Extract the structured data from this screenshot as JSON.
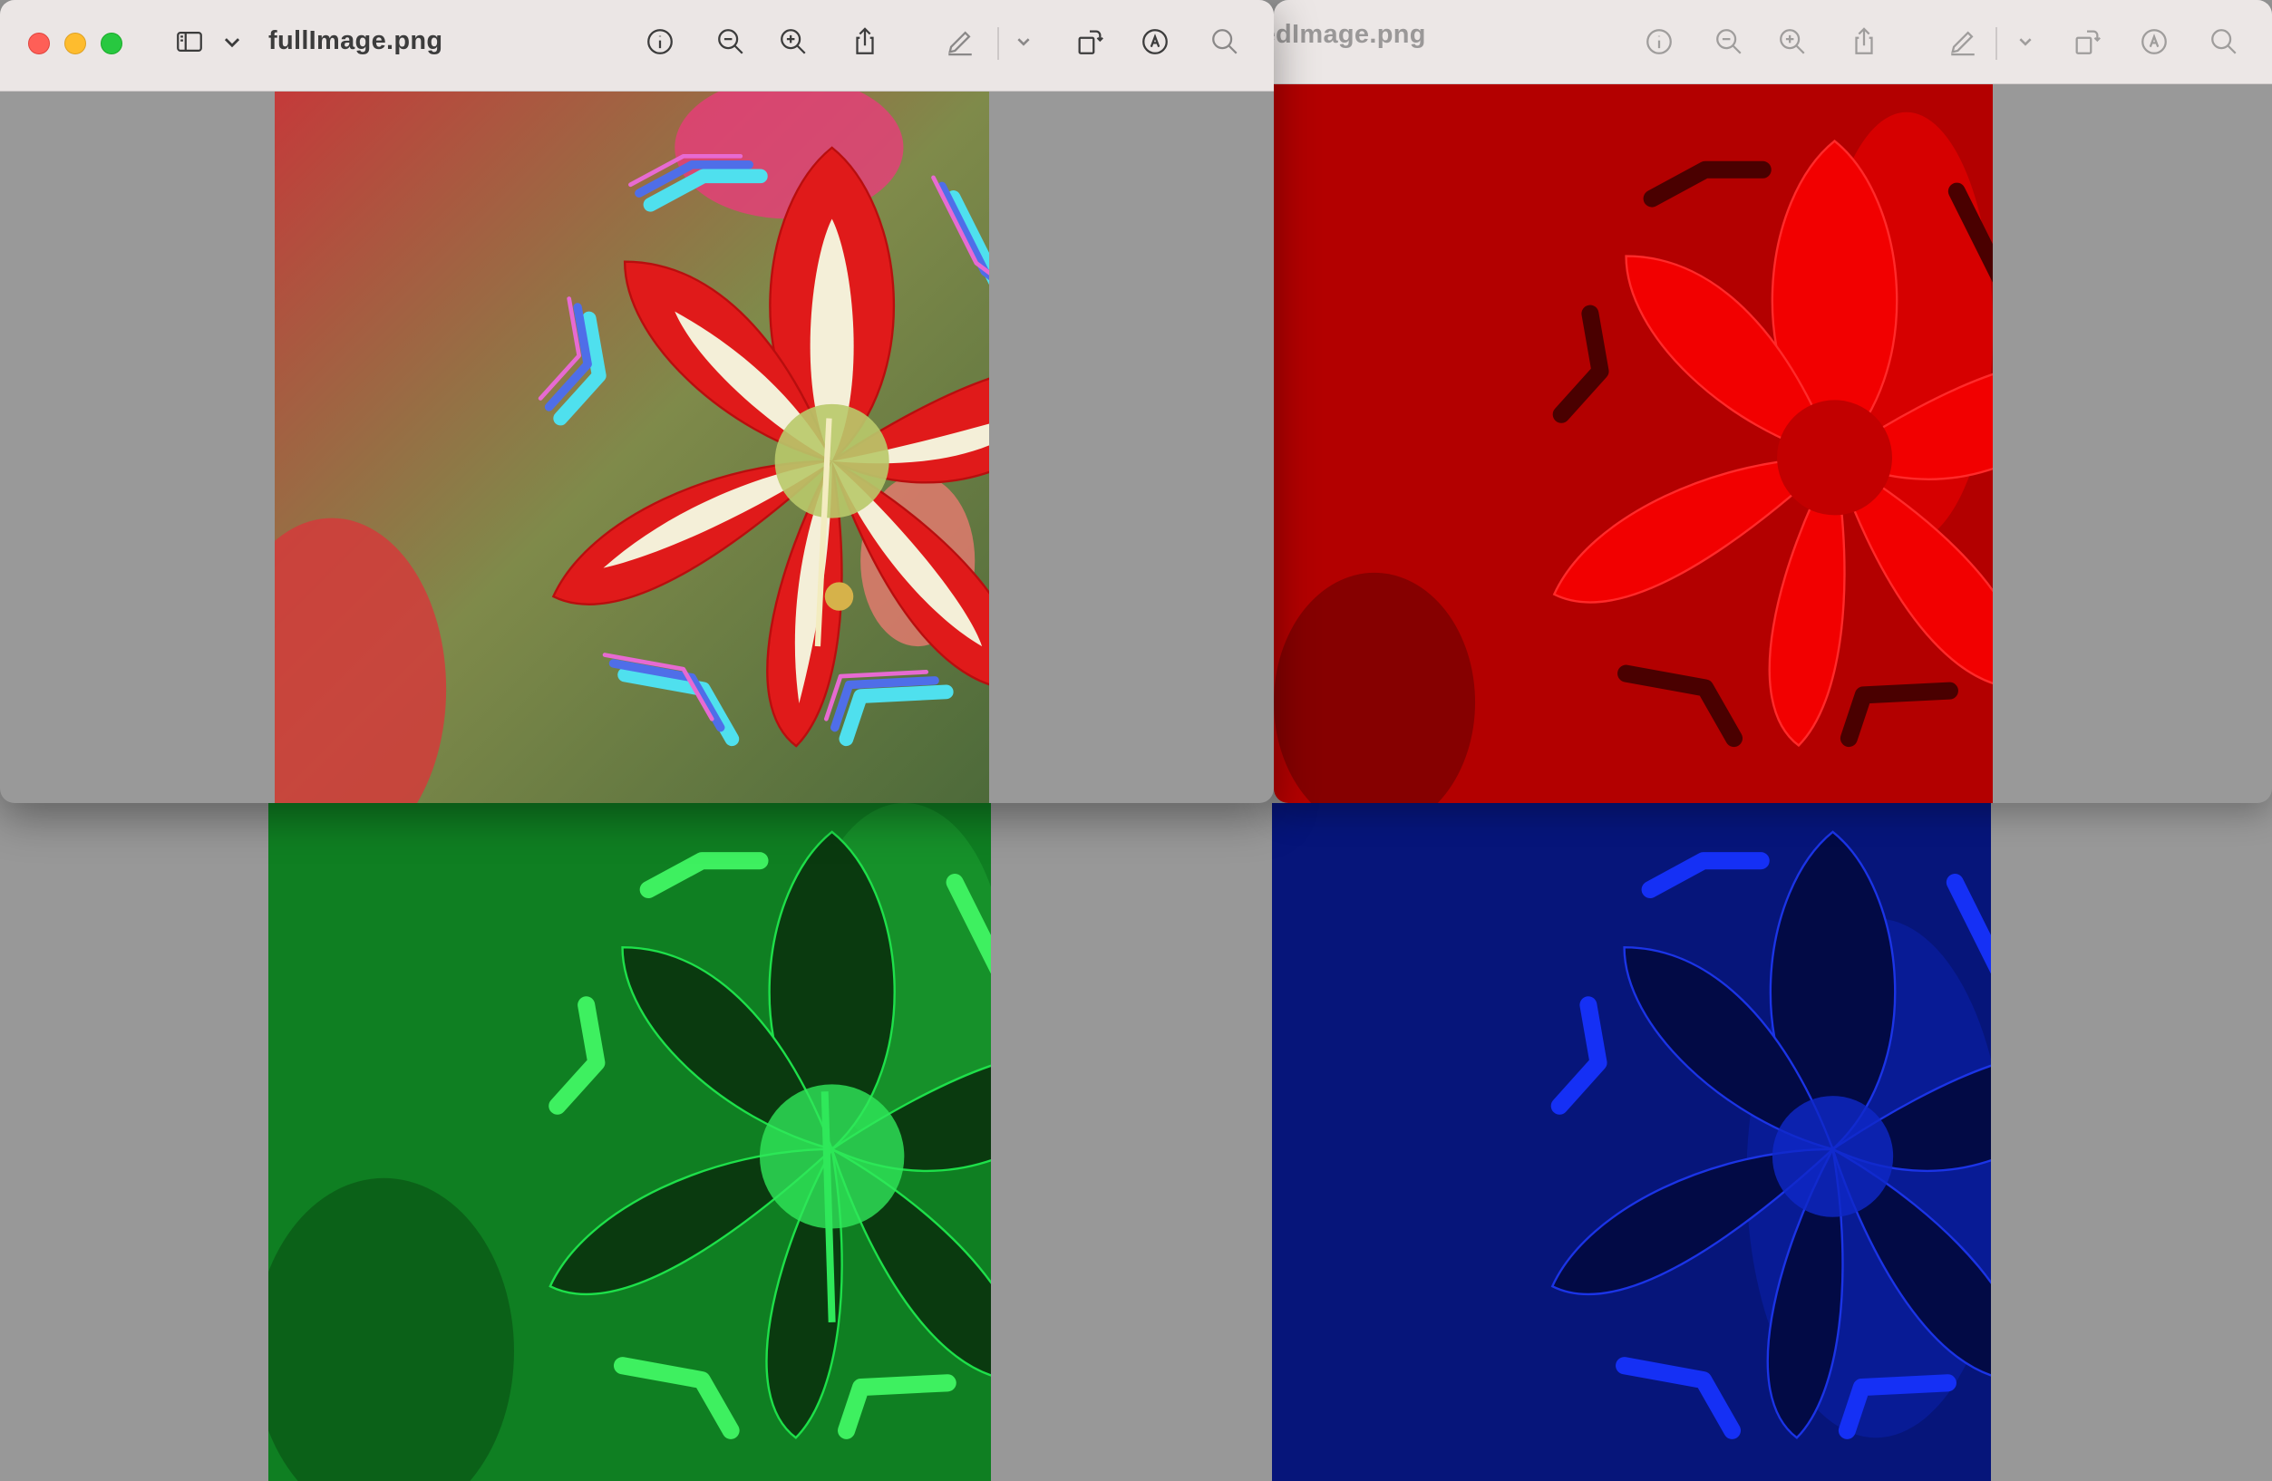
{
  "front_window": {
    "title": "fullImage.png",
    "icons": [
      "sidebar-icon",
      "chevron-down-icon",
      "info-icon",
      "zoom-out-icon",
      "zoom-in-icon",
      "share-icon",
      "markup-pen-icon",
      "chevron-down-icon",
      "rotate-icon",
      "markup-icon",
      "search-icon"
    ]
  },
  "back_window": {
    "title": "redImage.png",
    "icons": [
      "info-icon",
      "zoom-out-icon",
      "zoom-in-icon",
      "share-icon",
      "markup-pen-icon",
      "chevron-down-icon",
      "rotate-icon",
      "markup-icon",
      "search-icon"
    ]
  },
  "images": {
    "full": "amaryllis-full-color",
    "red": "amaryllis-red-channel",
    "green": "amaryllis-green-channel",
    "blue": "amaryllis-blue-channel"
  },
  "colors": {
    "desktop": "#989898",
    "toolbar": "#ebe6e5",
    "red_channel": "#e60000",
    "green_channel": "#12a82b",
    "blue_channel": "#0a1fb8",
    "annotation_cyan": "#4fe0ee",
    "annotation_blue": "#4f6ee8",
    "annotation_pink": "#e76ad2"
  }
}
